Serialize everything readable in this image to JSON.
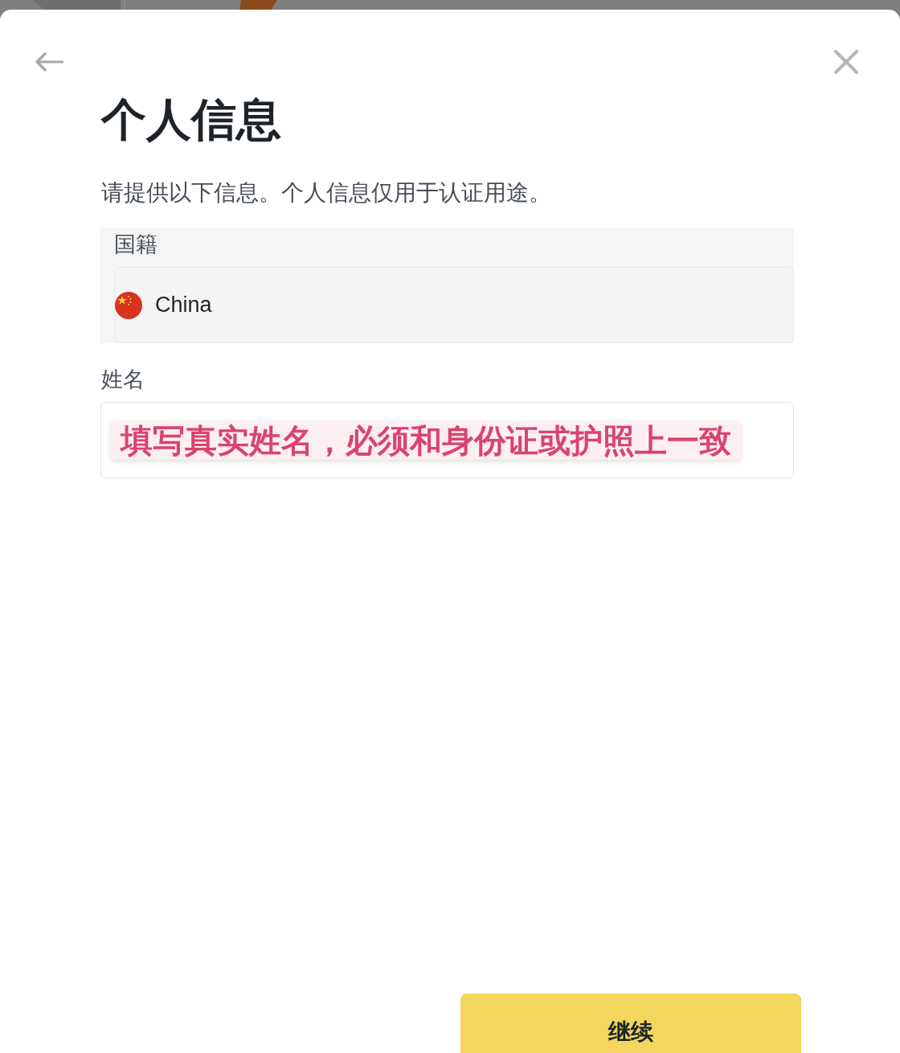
{
  "title": "个人信息",
  "subtitle": "请提供以下信息。个人信息仅用于认证用途。",
  "nationality": {
    "label": "国籍",
    "value": "China",
    "disabled": true
  },
  "name": {
    "label": "姓名",
    "annotation": "填写真实姓名，必须和身份证或护照上一致"
  },
  "continue_button": {
    "label": "继续"
  }
}
